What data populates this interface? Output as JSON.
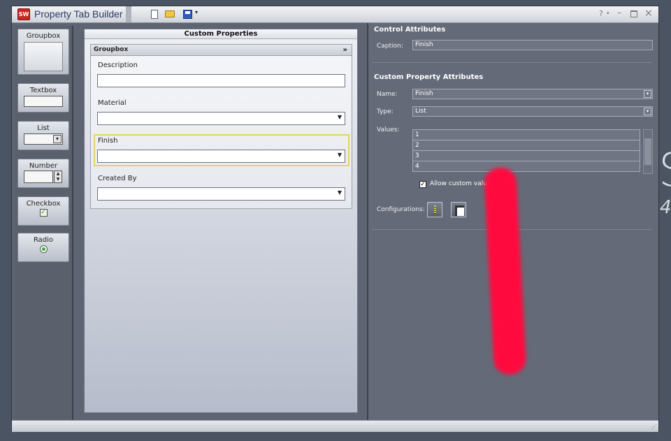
{
  "app": {
    "title": "Property Tab Builder",
    "logo_text": "SW"
  },
  "toolbar": {
    "icons": [
      "new-document-icon",
      "open-folder-icon",
      "save-icon"
    ],
    "help_label": "?"
  },
  "toolbox": {
    "items": [
      {
        "label": "Groupbox"
      },
      {
        "label": "Textbox"
      },
      {
        "label": "List"
      },
      {
        "label": "Number"
      },
      {
        "label": "Checkbox"
      },
      {
        "label": "Radio"
      }
    ]
  },
  "center": {
    "header": "Custom Properties",
    "groupbox_title": "Groupbox",
    "fields": [
      {
        "label": "Description",
        "type": "textbox",
        "value": ""
      },
      {
        "label": "Material",
        "type": "list",
        "value": ""
      },
      {
        "label": "Finish",
        "type": "list",
        "value": "",
        "selected": true
      },
      {
        "label": "Created By",
        "type": "list",
        "value": ""
      }
    ]
  },
  "right": {
    "control_attributes": {
      "heading": "Control Attributes",
      "caption_label": "Caption:",
      "caption_value": "Finish"
    },
    "custom_property_attributes": {
      "heading": "Custom Property Attributes",
      "name_label": "Name:",
      "name_value": "Finish",
      "type_label": "Type:",
      "type_value": "List",
      "values_label": "Values:",
      "values": [
        "1",
        "2",
        "3",
        "4"
      ],
      "allow_custom_values_label": "Allow custom values",
      "allow_custom_values_checked": true,
      "configurations_label": "Configurations:"
    }
  },
  "colors": {
    "desktop": "#4b5462",
    "panel": "#646a77",
    "selection_border": "#e7d266",
    "annotation": "#ff0a3f"
  }
}
